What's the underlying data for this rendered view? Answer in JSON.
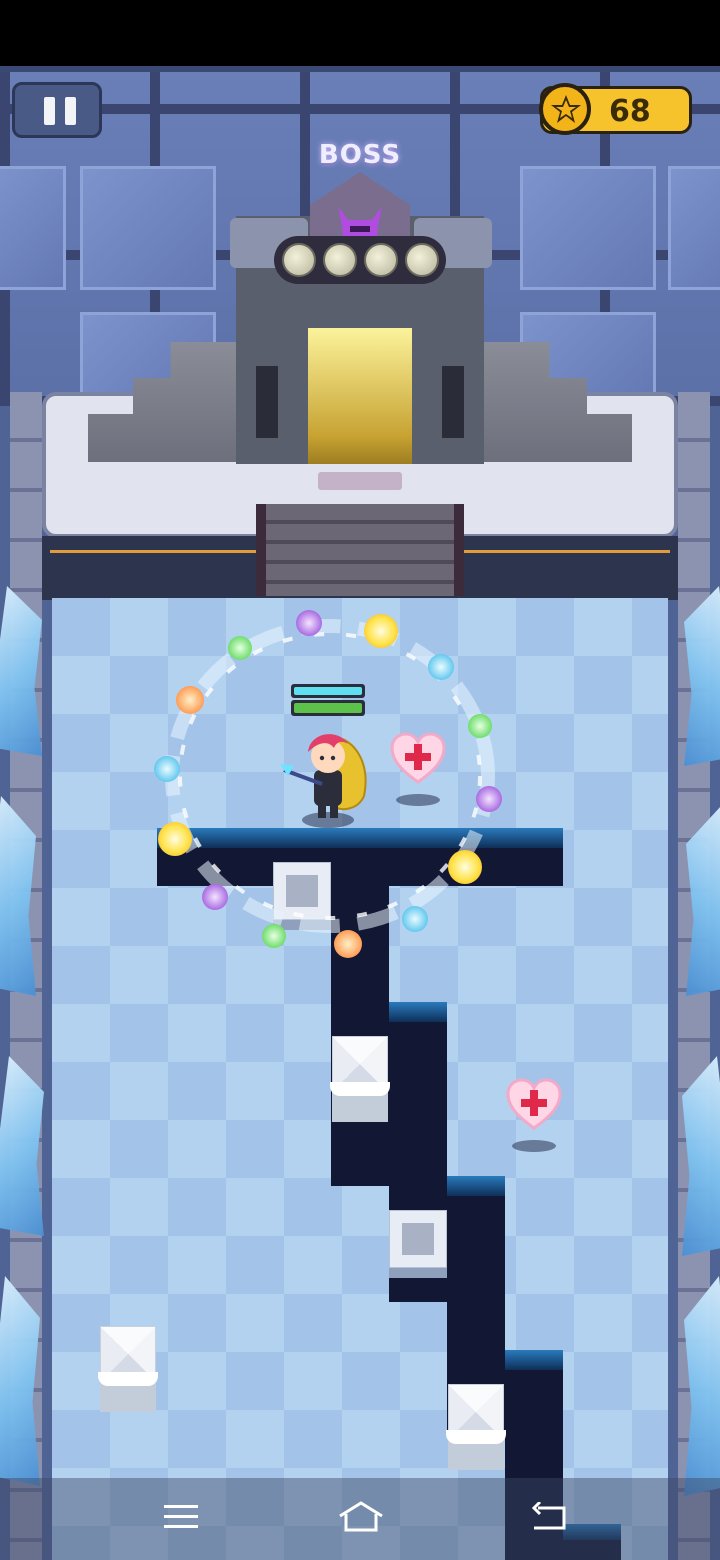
{
  "hud": {
    "pause_icon": "pause-icon",
    "coin_icon": "star-coin-icon",
    "coins": "68"
  },
  "boss_gate": {
    "label": "BOSS",
    "helmet_icon": "horned-helmet-icon",
    "stage_dot_count": 4
  },
  "colors": {
    "coin": "#f6c32d",
    "floor_light": "#b3d2f0",
    "floor_dark": "#a3c4e8",
    "pit": "#121834",
    "hp_shield": "#5ee0f0",
    "hp_health": "#5dc24a"
  },
  "player": {
    "shield_level": 1.0,
    "health_level": 1.0
  },
  "pickups": [
    "heart-health-icon",
    "heart-health-icon"
  ],
  "nav": {
    "menu_icon": "menu-icon",
    "home_icon": "home-icon",
    "back_icon": "back-icon"
  }
}
